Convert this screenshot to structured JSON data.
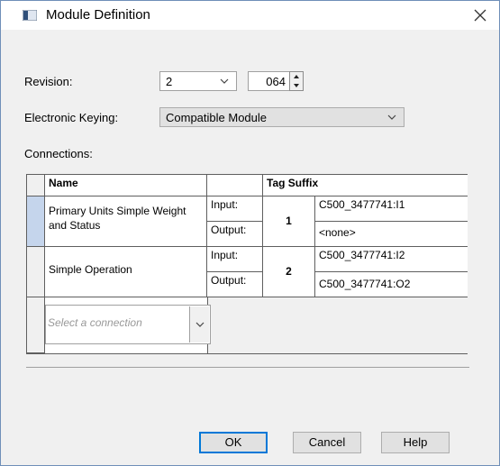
{
  "window": {
    "title": "Module Definition"
  },
  "revision": {
    "label": "Revision:",
    "major": "2",
    "minor": "064"
  },
  "keying": {
    "label": "Electronic Keying:",
    "value": "Compatible Module"
  },
  "connections": {
    "label": "Connections:",
    "headers": {
      "name": "Name",
      "tag_suffix": "Tag Suffix"
    },
    "rows": [
      {
        "name": "Primary Units Simple Weight and Status",
        "input_label": "Input:",
        "output_label": "Output:",
        "rpi": "1",
        "input_tag": "C500_3477741:I1",
        "output_tag": "<none>"
      },
      {
        "name": "Simple Operation",
        "input_label": "Input:",
        "output_label": "Output:",
        "rpi": "2",
        "input_tag": "C500_3477741:I2",
        "output_tag": "C500_3477741:O2"
      }
    ],
    "new_row_placeholder": "Select a connection"
  },
  "buttons": {
    "ok": "OK",
    "cancel": "Cancel",
    "help": "Help"
  }
}
